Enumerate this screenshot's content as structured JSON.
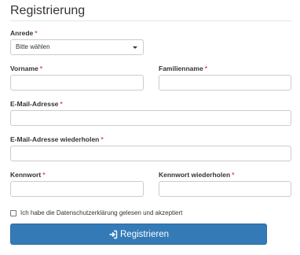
{
  "form": {
    "legend": "Registrierung",
    "required_marker": "*",
    "salutation": {
      "label": "Anrede",
      "value": "Bitte wählen"
    },
    "first_name": {
      "label": "Vorname",
      "value": ""
    },
    "last_name": {
      "label": "Familienname",
      "value": ""
    },
    "email": {
      "label": "E-Mail-Adresse",
      "value": ""
    },
    "email_repeat": {
      "label": "E-Mail-Adresse wiederholen",
      "value": ""
    },
    "password": {
      "label": "Kennwort",
      "value": ""
    },
    "password_repeat": {
      "label": "Kennwort wiederholen",
      "value": ""
    },
    "privacy_consent": {
      "label": "Ich habe die Datenschutzerklärung gelesen und akzeptiert",
      "checked": false
    },
    "submit": {
      "label": "Registrieren",
      "icon": "login-icon"
    }
  },
  "colors": {
    "primary": "#337ab7",
    "required": "#d9534f"
  }
}
